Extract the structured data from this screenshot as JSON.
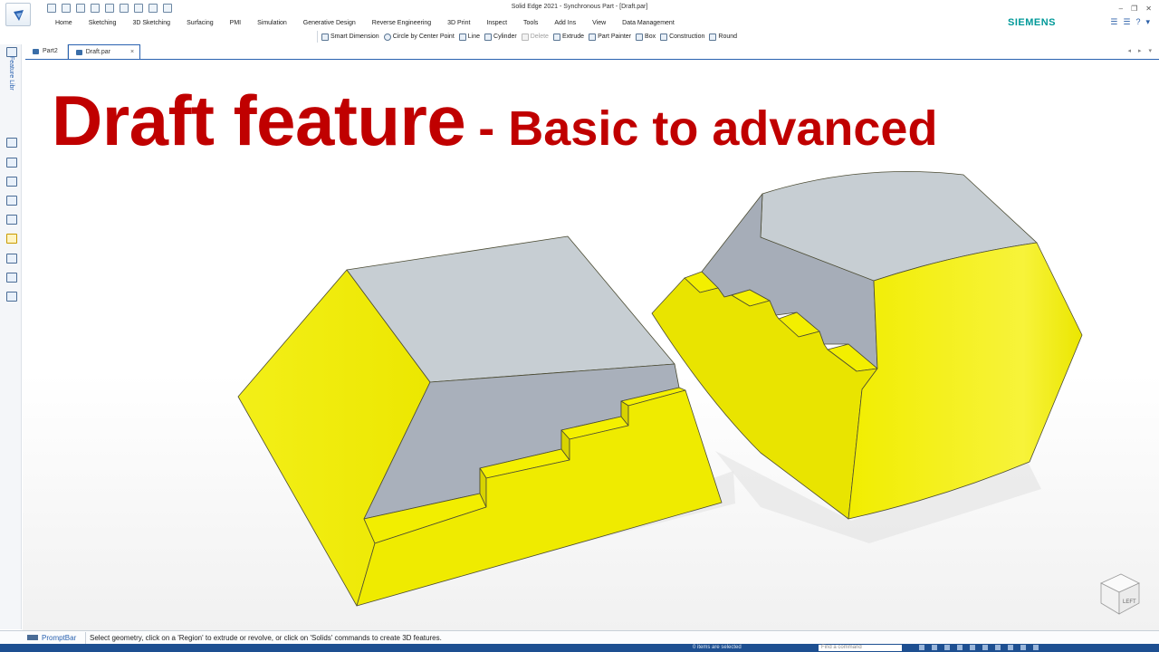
{
  "window": {
    "title": "Solid Edge 2021 - Synchronous Part - [Draft.par]",
    "brand": "SIEMENS",
    "controls": [
      "–",
      "❐",
      "✕"
    ]
  },
  "menu": [
    "Home",
    "Sketching",
    "3D Sketching",
    "Surfacing",
    "PMI",
    "Simulation",
    "Generative Design",
    "Reverse Engineering",
    "3D Print",
    "Inspect",
    "Tools",
    "Add Ins",
    "View",
    "Data Management"
  ],
  "commands": [
    {
      "label": "Smart Dimension",
      "icon": "smart-dimension-icon",
      "enabled": true
    },
    {
      "label": "Circle by Center Point",
      "icon": "circle-icon",
      "enabled": true
    },
    {
      "label": "Line",
      "icon": "line-icon",
      "enabled": true
    },
    {
      "label": "Cylinder",
      "icon": "cylinder-icon",
      "enabled": true
    },
    {
      "label": "Delete",
      "icon": "delete-icon",
      "enabled": false
    },
    {
      "label": "Extrude",
      "icon": "extrude-icon",
      "enabled": true
    },
    {
      "label": "Part Painter",
      "icon": "part-painter-icon",
      "enabled": true
    },
    {
      "label": "Box",
      "icon": "box-icon",
      "enabled": true
    },
    {
      "label": "Construction",
      "icon": "construction-icon",
      "enabled": true
    },
    {
      "label": "Round",
      "icon": "round-icon",
      "enabled": true
    }
  ],
  "tabs": [
    {
      "label": "Part2",
      "active": false
    },
    {
      "label": "Draft.par",
      "active": true,
      "close": "×"
    }
  ],
  "tab_nav": [
    "◂",
    "▸",
    "▾"
  ],
  "sidebar": {
    "feature_library_label": "Feature Libr",
    "icons": [
      "feature-library-icon",
      "assembly-icon",
      "layers-icon",
      "view-icon",
      "tree-icon",
      "color-icon",
      "key-icon",
      "measure-icon",
      "relations-icon",
      "settings-icon"
    ]
  },
  "headline": {
    "main": "Draft feature",
    "sub": "- Basic to advanced",
    "color": "#c00000"
  },
  "viewport": {
    "face_yellow": "#f0ec00",
    "face_yellow_dark": "#e2dd00",
    "face_gray": "#c6cdd2",
    "face_gray_dark": "#a9b0ba",
    "edge": "#4a4a3a",
    "view_cube_label": "LEFT"
  },
  "prompt_bar": {
    "label": "PromptBar",
    "message": "Select geometry, click on a 'Region' to extrude or revolve, or click on 'Solids' commands to create 3D features."
  },
  "status_bar": {
    "selection": "0 items are selected",
    "find_placeholder": "Find a command"
  }
}
